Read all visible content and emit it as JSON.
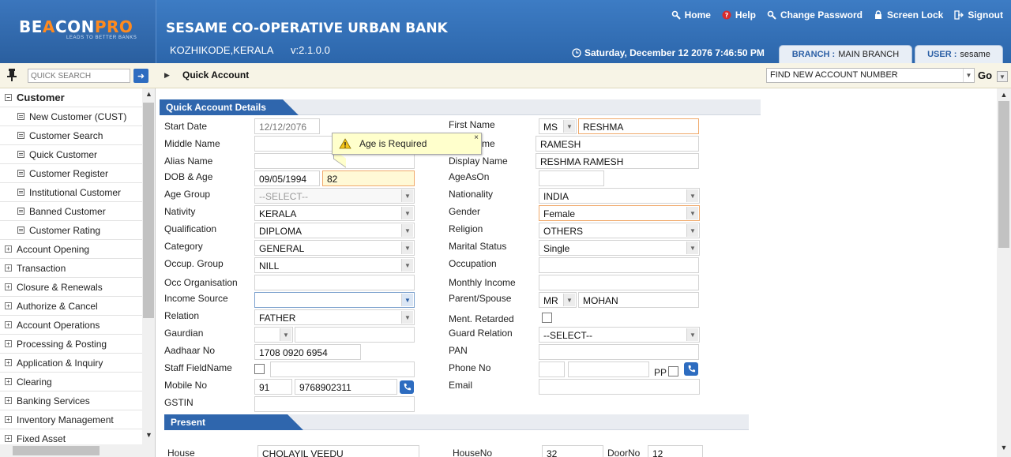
{
  "header": {
    "logo_pre": "BE",
    "logo_mid": "A",
    "logo_post": "CON",
    "logo_accent": "PRO",
    "logo_tagline": "LEADS TO BETTER BANKS",
    "bank_name": "SESAME CO-OPERATIVE URBAN BANK",
    "location": "KOZHIKODE,KERALA",
    "version": "v:2.1.0.0",
    "links": [
      {
        "label": "Home",
        "icon": "home-icon"
      },
      {
        "label": "Help",
        "icon": "help-icon"
      },
      {
        "label": "Change Password",
        "icon": "key-icon"
      },
      {
        "label": "Screen Lock",
        "icon": "lock-icon"
      },
      {
        "label": "Signout",
        "icon": "signout-icon"
      }
    ],
    "datetime": "Saturday, December 12 2076 7:46:50 PM",
    "branch_key": "BRANCH :",
    "branch_val": "MAIN BRANCH",
    "user_key": "USER :",
    "user_val": "sesame",
    "brand_color": "#2f66ad",
    "accent_color": "#ff8a1e"
  },
  "toolbar": {
    "search_placeholder": "QUICK SEARCH",
    "search_go": "➜",
    "breadcrumb": "Quick Account",
    "find_value": "FIND NEW ACCOUNT NUMBER",
    "go_label": "Go"
  },
  "sidebar": {
    "open_group": "Customer",
    "items": [
      "New Customer (CUST)",
      "Customer Search",
      "Quick Customer",
      "Customer Register",
      "Institutional Customer",
      "Banned Customer",
      "Customer Rating"
    ],
    "groups": [
      "Account Opening",
      "Transaction",
      "Closure & Renewals",
      "Authorize & Cancel",
      "Account Operations",
      "Processing & Posting",
      "Application & Inquiry",
      "Clearing",
      "Banking Services",
      "Inventory Management",
      "Fixed Asset"
    ]
  },
  "form": {
    "section_title": "Quick Account Details",
    "labels": {
      "start_date": "Start Date",
      "middle_name": "Middle Name",
      "alias_name": "Alias Name",
      "dob_age": "DOB & Age",
      "age_group": "Age Group",
      "nativity": "Nativity",
      "qualification": "Qualification",
      "category": "Category",
      "occup_group": "Occup. Group",
      "occ_org": "Occ Organisation",
      "income_source": "Income Source",
      "relation": "Relation",
      "gaurdian": "Gaurdian",
      "aadhaar": "Aadhaar No",
      "staff_fieldname": "Staff FieldName",
      "mobile": "Mobile No",
      "gstin": "GSTIN",
      "first_name": "First Name",
      "last_name_suffix": "me",
      "display_name": "Display Name",
      "age_as_on": "AgeAsOn",
      "nationality": "Nationality",
      "gender": "Gender",
      "religion": "Religion",
      "marital_status": "Marital Status",
      "occupation": "Occupation",
      "monthly_income": "Monthly Income",
      "parent_spouse": "Parent/Spouse",
      "ment_retarded": "Ment. Retarded",
      "guard_relation": "Guard Relation",
      "pan": "PAN",
      "phone": "Phone No",
      "pp": "PP",
      "email": "Email"
    },
    "values": {
      "start_date": "12/12/2076",
      "dob": "09/05/1994",
      "age": "82",
      "age_group": "--SELECT--",
      "nativity": "KERALA",
      "qualification": "DIPLOMA",
      "category": "GENERAL",
      "occup_group": "NILL",
      "relation": "FATHER",
      "aadhaar": "1708 0920 6954",
      "mobile_code": "91",
      "mobile": "9768902311",
      "first_title": "MS",
      "first_name": "RESHMA",
      "last_name": "RAMESH",
      "display_name": "RESHMA RAMESH",
      "nationality": "INDIA",
      "gender": "Female",
      "religion": "OTHERS",
      "marital_status": "Single",
      "parent_title": "MR",
      "parent_name": "MOHAN",
      "guard_relation": "--SELECT--"
    },
    "tooltip": "Age is Required",
    "tooltip_close": "×"
  },
  "present": {
    "section_title": "Present",
    "house_label": "House",
    "house_value": "CHOLAYIL VEEDU",
    "houseno_label": "HouseNo",
    "houseno_value": "32",
    "doorno_label": "DoorNo",
    "doorno_value": "12"
  }
}
